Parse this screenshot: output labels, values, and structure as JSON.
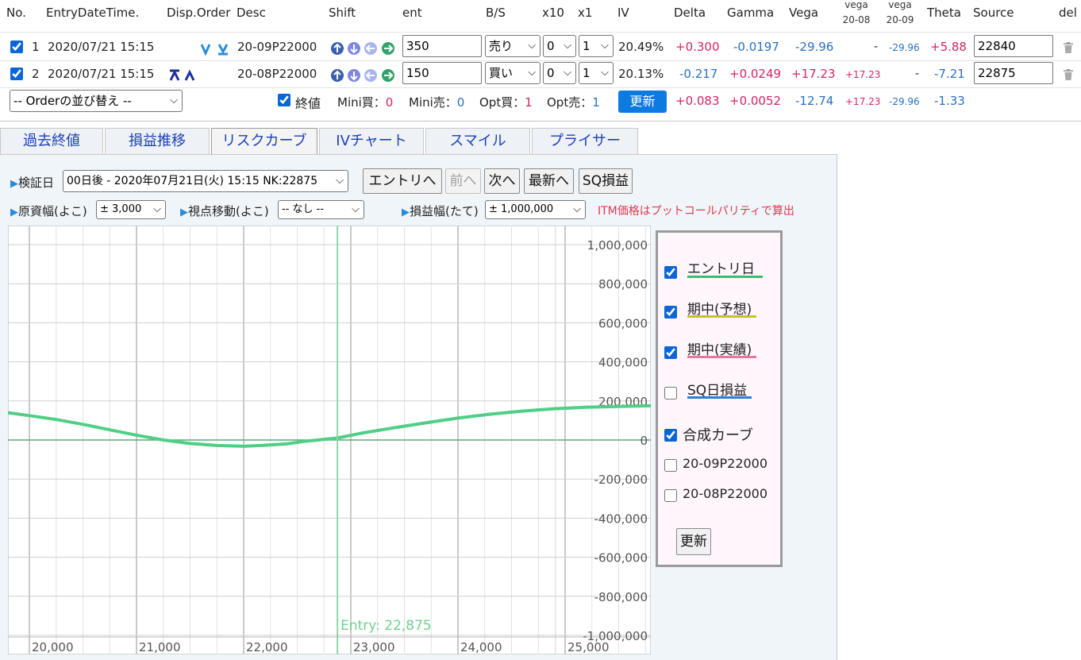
{
  "header": {
    "no": "No.",
    "entry": "EntryDateTime.",
    "disp": "Disp.Order",
    "desc": "Desc",
    "shift": "Shift",
    "ent": "ent",
    "bs": "B/S",
    "x10": "x10",
    "x1": "x1",
    "iv": "IV",
    "delta": "Delta",
    "gamma": "Gamma",
    "vega": "Vega",
    "vega1a": "vega",
    "vega1b": "20-08",
    "vega2a": "vega",
    "vega2b": "20-09",
    "theta": "Theta",
    "source": "Source",
    "del": "del"
  },
  "rows": [
    {
      "no": "1",
      "datetime": "2020/07/21 15:15",
      "desc": "20-09P22000",
      "ent": "350",
      "bs": "売り",
      "x10": "0",
      "x1": "1",
      "iv": "20.49%",
      "delta": "+0.300",
      "gamma": "-0.0197",
      "vega": "-29.96",
      "vega0808": "-",
      "vega0909": "-29.96",
      "theta": "+5.88",
      "source": "22840"
    },
    {
      "no": "2",
      "datetime": "2020/07/21 15:15",
      "desc": "20-08P22000",
      "ent": "150",
      "bs": "買い",
      "x10": "0",
      "x1": "1",
      "iv": "20.13%",
      "delta": "-0.217",
      "gamma": "+0.0249",
      "vega": "+17.23",
      "vega0808": "+17.23",
      "vega0909": "-",
      "theta": "-7.21",
      "source": "22875"
    }
  ],
  "summary": {
    "order_select": "-- Orderの並び替え --",
    "close_label": "終値",
    "mini_buy_label": "Mini買：",
    "mini_buy": "0",
    "mini_sell_label": "Mini売：",
    "mini_sell": "0",
    "opt_buy_label": "Opt買：",
    "opt_buy": "1",
    "opt_sell_label": "Opt売：",
    "opt_sell": "1",
    "update": "更新",
    "delta": "+0.083",
    "gamma": "+0.0052",
    "vega": "-12.74",
    "vega0808": "+17.23",
    "vega0909": "-29.96",
    "theta": "-1.33"
  },
  "tabs": [
    "過去終値",
    "損益推移",
    "リスクカーブ",
    "IVチャート",
    "スマイル",
    "プライサー"
  ],
  "controls": {
    "verify_label": "検証日",
    "verify_value": "00日後 - 2020年07月21日(火) 15:15 NK:22875",
    "btn_entry": "エントリへ",
    "btn_prev": "前へ",
    "btn_next": "次へ",
    "btn_latest": "最新へ",
    "btn_sq": "SQ損益",
    "range_label": "原資幅(よこ)",
    "range_value": "± 3,000",
    "view_label": "視点移動(よこ)",
    "view_value": "-- なし --",
    "pl_label": "損益幅(たて)",
    "pl_value": "± 1,000,000",
    "note": "ITM価格はプットコールパリティで算出"
  },
  "legend": {
    "entry_day": "エントリ日",
    "mid_forecast": "期中(予想)",
    "mid_actual": "期中(実績)",
    "sq_pl": "SQ日損益",
    "composite": "合成カーブ",
    "leg1": "20-09P22000",
    "leg2": "20-08P22000",
    "update": "更新"
  },
  "chart_data": {
    "type": "line",
    "xlim": [
      19800,
      25800
    ],
    "ylim": [
      -1000000,
      1000000
    ],
    "xticks": [
      20000,
      21000,
      22000,
      23000,
      24000,
      25000
    ],
    "xtick_labels": [
      "20,000",
      "21,000",
      "22,000",
      "23,000",
      "24,000",
      "25,000"
    ],
    "yticks": [
      1000000,
      800000,
      600000,
      400000,
      200000,
      0,
      -200000,
      -400000,
      -600000,
      -800000,
      -1000000
    ],
    "ytick_labels": [
      "1,000,000",
      "800,000",
      "600,000",
      "400,000",
      "200,000",
      "0",
      "-200,000",
      "-400,000",
      "-600,000",
      "-800,000",
      "-1,000,000"
    ],
    "entry_x": 22875,
    "entry_label": "Entry: 22,875",
    "series": [
      {
        "color": "#4fcf86",
        "x": [
          19800,
          20000,
          20250,
          20500,
          20750,
          21000,
          21250,
          21500,
          21750,
          22000,
          22200,
          22400,
          22600,
          22875,
          23100,
          23400,
          23700,
          24000,
          24300,
          24600,
          24900,
          25200,
          25500,
          25800
        ],
        "y": [
          140000,
          125000,
          105000,
          80000,
          52000,
          25000,
          0,
          -18000,
          -28000,
          -32000,
          -27000,
          -20000,
          -5000,
          10000,
          35000,
          62000,
          88000,
          112000,
          132000,
          148000,
          160000,
          168000,
          172000,
          175000
        ]
      }
    ],
    "grid": true
  },
  "colors": {
    "entry_line": "#3dbb6e",
    "forecast_line": "#c9c21a",
    "actual_line": "#e678a0",
    "sq_line": "#2a7fd6"
  }
}
